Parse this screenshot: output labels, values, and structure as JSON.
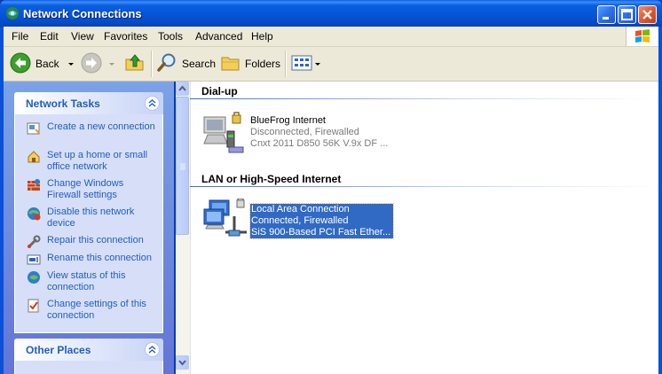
{
  "window": {
    "title": "Network Connections"
  },
  "menu": {
    "items": [
      "File",
      "Edit",
      "View",
      "Favorites",
      "Tools",
      "Advanced",
      "Help"
    ]
  },
  "toolbar": {
    "back_label": "Back",
    "search_label": "Search",
    "folders_label": "Folders"
  },
  "sidebar": {
    "network_tasks": {
      "title": "Network Tasks",
      "items": [
        {
          "label": "Create a new connection",
          "icon": "new-connection-icon"
        },
        {
          "label": "Set up a home or small office network",
          "icon": "home-network-icon"
        },
        {
          "label": "Change Windows Firewall settings",
          "icon": "firewall-icon"
        },
        {
          "label": "Disable this network device",
          "icon": "disable-device-icon"
        },
        {
          "label": "Repair this connection",
          "icon": "repair-icon"
        },
        {
          "label": "Rename this connection",
          "icon": "rename-icon"
        },
        {
          "label": "View status of this connection",
          "icon": "status-icon"
        },
        {
          "label": "Change settings of this connection",
          "icon": "settings-icon"
        }
      ]
    },
    "other_places": {
      "title": "Other Places"
    }
  },
  "groups": [
    {
      "title": "Dial-up",
      "connections": [
        {
          "name": "BlueFrog Internet",
          "status": "Disconnected, Firewalled",
          "device": "Cnxt 2011 D850 56K V.9x DF ...",
          "icon": "dialup-modem-icon",
          "selected": false
        }
      ]
    },
    {
      "title": "LAN or High-Speed Internet",
      "connections": [
        {
          "name": "Local Area Connection",
          "status": "Connected, Firewalled",
          "device": "SiS 900-Based PCI Fast Ether...",
          "icon": "lan-connection-icon",
          "selected": true
        }
      ]
    }
  ],
  "colors": {
    "titlebar": "#0554d6",
    "task_link": "#215dc6",
    "selection": "#316ac5",
    "panel_bg": "#d6dff7"
  }
}
